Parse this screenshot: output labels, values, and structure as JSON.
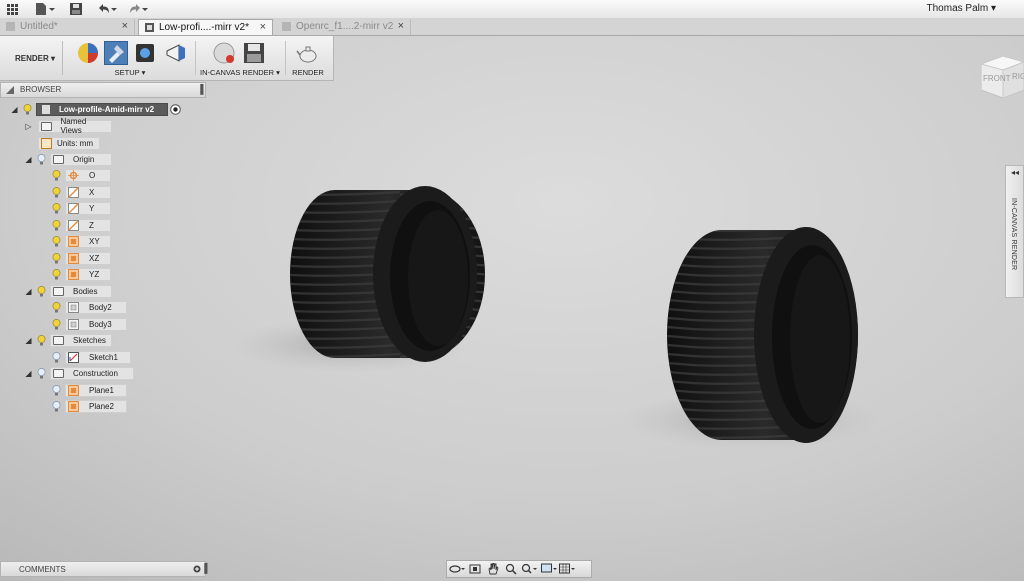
{
  "app": {
    "user": "Thomas Palm ▾"
  },
  "tabs": [
    {
      "label": "Untitled*",
      "active": false
    },
    {
      "label": "Low-profi....-mirr v2*",
      "active": true
    },
    {
      "label": "Openrc_f1....2-mirr v2",
      "active": false
    }
  ],
  "ribbon": {
    "workspace": "RENDER ▾",
    "groups": {
      "setup": "SETUP ▾",
      "incanvas": "IN-CANVAS RENDER ▾",
      "render": "RENDER"
    }
  },
  "browser": {
    "title": "BROWSER",
    "root": "Low-profile-Amid-mirr v2",
    "named_views": "Named Views",
    "units": "Units: mm",
    "origin": {
      "label": "Origin",
      "items": [
        "O",
        "X",
        "Y",
        "Z",
        "XY",
        "XZ",
        "YZ"
      ]
    },
    "bodies": {
      "label": "Bodies",
      "items": [
        "Body2",
        "Body3"
      ]
    },
    "sketches": {
      "label": "Sketches",
      "items": [
        "Sketch1"
      ]
    },
    "construction": {
      "label": "Construction",
      "items": [
        "Plane1",
        "Plane2"
      ]
    }
  },
  "viewcube": {
    "face_front": "FRONT",
    "face_right": "RIGHT"
  },
  "right_panel": {
    "label": "IN-CANVAS RENDER"
  },
  "comments": {
    "title": "COMMENTS"
  },
  "colors": {
    "selected_tool": "#4f7fb7",
    "root_node": "#5b5b5b",
    "bulb": "#f0d23c",
    "plane_orange": "#e6893a"
  }
}
